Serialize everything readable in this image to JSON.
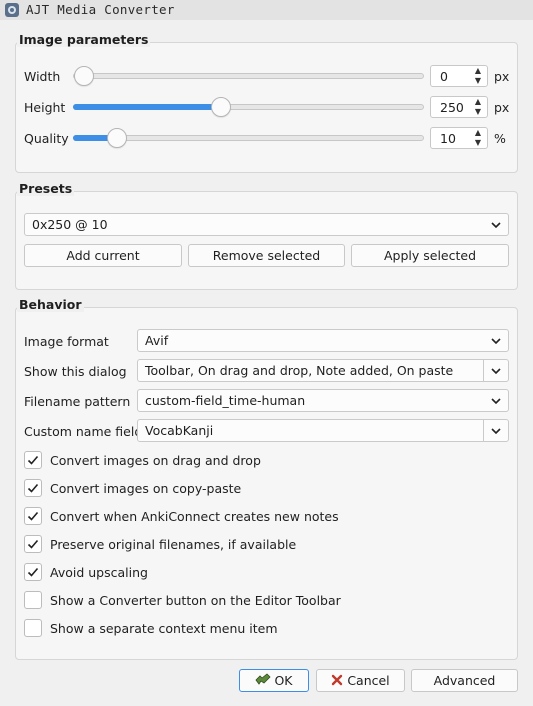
{
  "window": {
    "title": "AJT Media Converter"
  },
  "image_parameters": {
    "title": "Image parameters",
    "width": {
      "label": "Width",
      "value": "0",
      "unit": "px",
      "fraction": 0.0
    },
    "height": {
      "label": "Height",
      "value": "250",
      "unit": "px",
      "fraction": 0.42
    },
    "quality": {
      "label": "Quality",
      "value": "10",
      "unit": "%",
      "fraction": 0.12
    }
  },
  "presets": {
    "title": "Presets",
    "selected": "0x250 @ 10",
    "add_label": "Add current",
    "remove_label": "Remove selected",
    "apply_label": "Apply selected"
  },
  "behavior": {
    "title": "Behavior",
    "image_format": {
      "label": "Image format",
      "value": "Avif"
    },
    "show_dialog": {
      "label": "Show this dialog",
      "value": "Toolbar, On drag and drop, Note added, On paste"
    },
    "filename_pattern": {
      "label": "Filename pattern",
      "value": "custom-field_time-human"
    },
    "custom_name_field": {
      "label": "Custom name field",
      "value": "VocabKanji"
    },
    "checkboxes": [
      {
        "label": "Convert images on drag and drop",
        "checked": true
      },
      {
        "label": "Convert images on copy-paste",
        "checked": true
      },
      {
        "label": "Convert when AnkiConnect creates new notes",
        "checked": true
      },
      {
        "label": "Preserve original filenames, if available",
        "checked": true
      },
      {
        "label": "Avoid upscaling",
        "checked": true
      },
      {
        "label": "Show a Converter button on the Editor Toolbar",
        "checked": false
      },
      {
        "label": "Show a separate context menu item",
        "checked": false
      }
    ]
  },
  "buttons": {
    "ok": "OK",
    "cancel": "Cancel",
    "advanced": "Advanced"
  },
  "colors": {
    "accent": "#3c8ee6",
    "cancel_icon": "#c0392b",
    "ok_icon": "#5d8a3a"
  }
}
